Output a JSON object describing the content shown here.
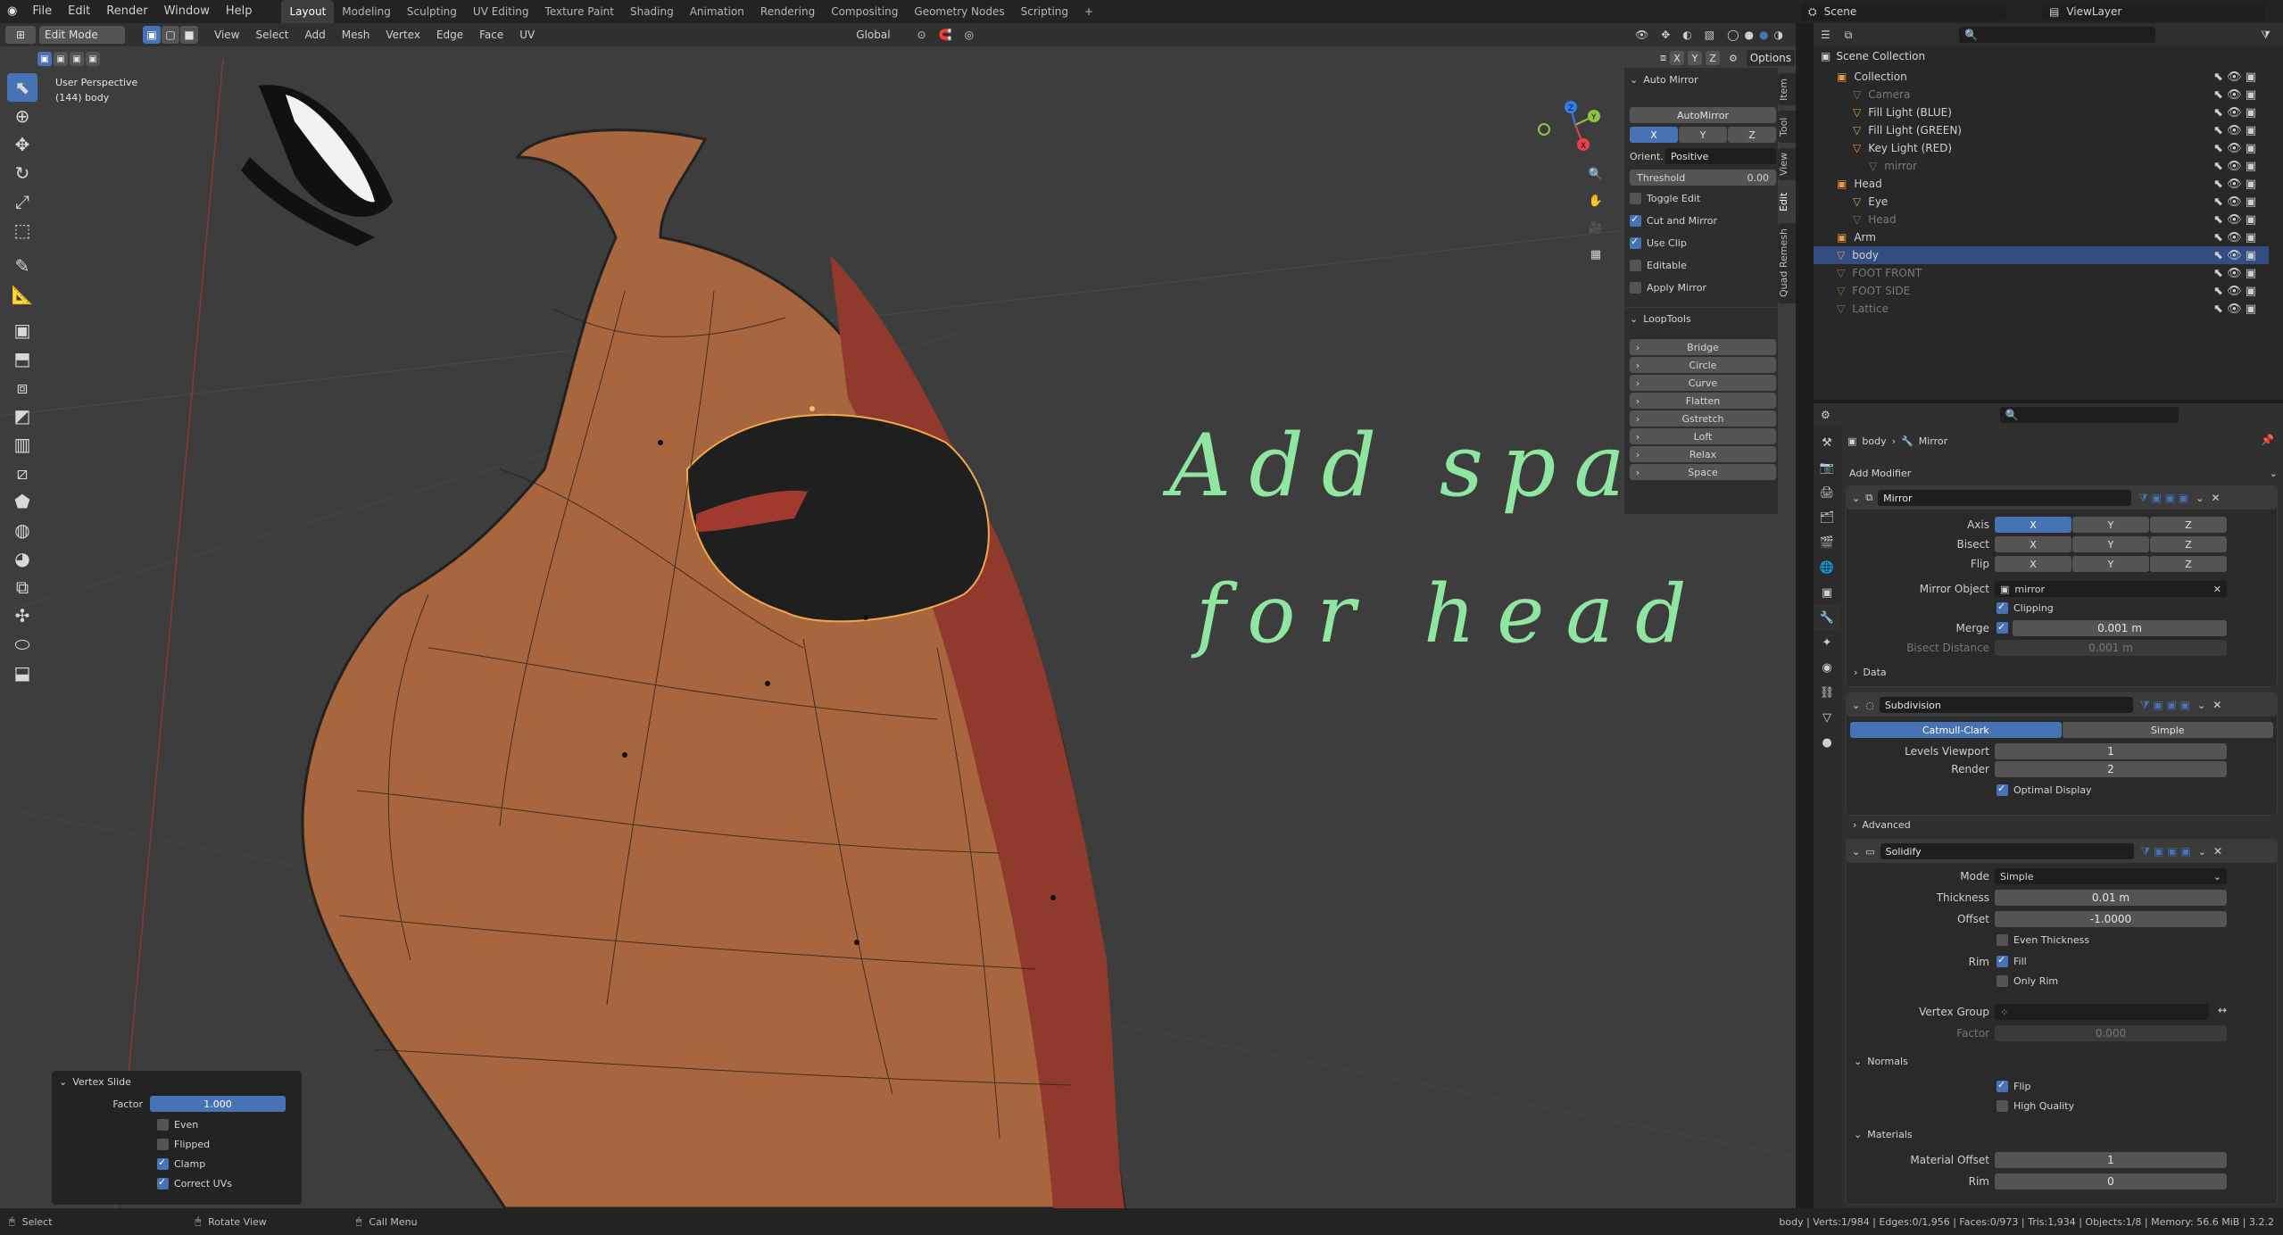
{
  "menu": {
    "items": [
      "File",
      "Edit",
      "Render",
      "Window",
      "Help"
    ]
  },
  "workspaces": [
    "Layout",
    "Modeling",
    "Sculpting",
    "UV Editing",
    "Texture Paint",
    "Shading",
    "Animation",
    "Rendering",
    "Compositing",
    "Geometry Nodes",
    "Scripting"
  ],
  "active_workspace": "Layout",
  "scene": {
    "name": "Scene",
    "viewlayer": "ViewLayer"
  },
  "viewport": {
    "mode": "Edit Mode",
    "menus": [
      "View",
      "Select",
      "Add",
      "Mesh",
      "Vertex",
      "Edge",
      "Face",
      "UV"
    ],
    "orientation": "Global",
    "options_label": "Options",
    "xyz": [
      "X",
      "Y",
      "Z"
    ],
    "info_line1": "User Perspective",
    "info_line2": "(144) body",
    "annotation_line1": "Add space",
    "annotation_line2": "for head"
  },
  "npanel": {
    "tabs": [
      "Item",
      "Tool",
      "View",
      "Edit",
      "Quad Remesh"
    ],
    "automirror": {
      "title": "Auto Mirror",
      "button": "AutoMirror",
      "axes": [
        "X",
        "Y",
        "Z"
      ],
      "orient_label": "Orient.",
      "orient_value": "Positive",
      "threshold_label": "Threshold",
      "threshold_value": "0.00",
      "toggle_edit": "Toggle Edit",
      "cut_and_mirror": "Cut and Mirror",
      "use_clip": "Use Clip",
      "editable": "Editable",
      "apply_mirror": "Apply Mirror"
    },
    "looptools": {
      "title": "LoopTools",
      "items": [
        "Bridge",
        "Circle",
        "Curve",
        "Flatten",
        "Gstretch",
        "Loft",
        "Relax",
        "Space"
      ]
    }
  },
  "operator_panel": {
    "title": "Vertex Slide",
    "factor_label": "Factor",
    "factor_value": "1.000",
    "even": "Even",
    "flipped": "Flipped",
    "clamp": "Clamp",
    "correct_uvs": "Correct UVs"
  },
  "outliner": {
    "root": "Scene Collection",
    "rows": [
      {
        "label": "Collection",
        "indent": 1
      },
      {
        "label": "Camera",
        "indent": 2,
        "dim": true
      },
      {
        "label": "Fill Light (BLUE)",
        "indent": 2
      },
      {
        "label": "Fill Light (GREEN)",
        "indent": 2
      },
      {
        "label": "Key Light (RED)",
        "indent": 2
      },
      {
        "label": "mirror",
        "indent": 3,
        "dim": true
      },
      {
        "label": "Head",
        "indent": 1
      },
      {
        "label": "Eye",
        "indent": 2
      },
      {
        "label": "Head",
        "indent": 2,
        "dim": true
      },
      {
        "label": "Arm",
        "indent": 1
      },
      {
        "label": "body",
        "indent": 1,
        "selected": true
      },
      {
        "label": "FOOT FRONT",
        "indent": 1,
        "dim": true
      },
      {
        "label": "FOOT SIDE",
        "indent": 1,
        "dim": true
      },
      {
        "label": "Lattice",
        "indent": 1,
        "dim": true
      }
    ]
  },
  "properties": {
    "breadcrumb_object": "body",
    "breadcrumb_modifier": "Mirror",
    "add_modifier": "Add Modifier",
    "mirror": {
      "name": "Mirror",
      "axis_label": "Axis",
      "bisect_label": "Bisect",
      "flip_label": "Flip",
      "xyz": [
        "X",
        "Y",
        "Z"
      ],
      "mirror_object_label": "Mirror Object",
      "mirror_object_value": "mirror",
      "clipping": "Clipping",
      "merge_label": "Merge",
      "merge_value": "0.001 m",
      "bisect_distance_label": "Bisect Distance",
      "bisect_distance_value": "0.001 m",
      "data": "Data"
    },
    "subdivision": {
      "name": "Subdivision",
      "catmull": "Catmull-Clark",
      "simple": "Simple",
      "levels_viewport_label": "Levels Viewport",
      "levels_viewport_value": "1",
      "render_label": "Render",
      "render_value": "2",
      "optimal_display": "Optimal Display",
      "advanced": "Advanced"
    },
    "solidify": {
      "name": "Solidify",
      "mode_label": "Mode",
      "mode_value": "Simple",
      "thickness_label": "Thickness",
      "thickness_value": "0.01 m",
      "offset_label": "Offset",
      "offset_value": "-1.0000",
      "even_thickness": "Even Thickness",
      "rim_label": "Rim",
      "fill": "Fill",
      "only_rim": "Only Rim",
      "vertex_group_label": "Vertex Group",
      "factor_label": "Factor",
      "factor_value": "0.000",
      "normals": "Normals",
      "flip": "Flip",
      "high_quality": "High Quality",
      "materials": "Materials",
      "material_offset_label": "Material Offset",
      "material_offset_value": "1",
      "rim_mat_label": "Rim",
      "rim_mat_value": "0"
    }
  },
  "statusbar": {
    "select": "Select",
    "rotate": "Rotate View",
    "call_menu": "Call Menu",
    "stats": "body | Verts:1/984 | Edges:0/1,956 | Faces:0/973 | Tris:1,934 | Objects:1/8 | Memory: 56.6 MiB | 3.2.2"
  },
  "colors": {
    "accent": "#4772b3",
    "annotation": "#8fe6a0",
    "mesh_orange": "#a8663e",
    "mesh_red": "#8f3a2c"
  }
}
